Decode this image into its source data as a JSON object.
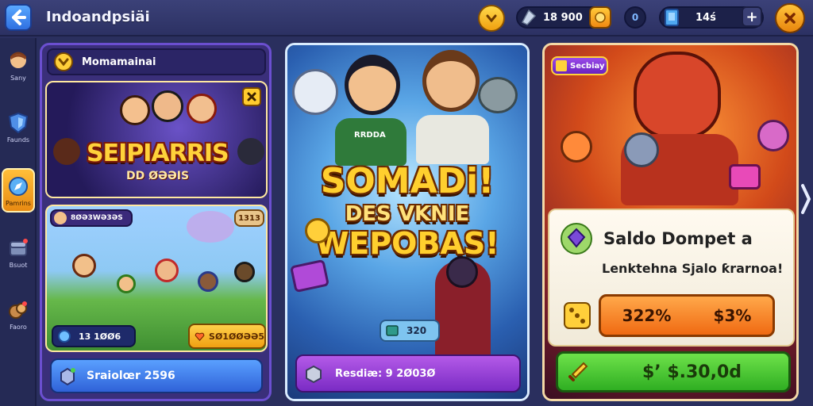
{
  "header": {
    "title": "Indoandpsiäi",
    "currency_1": "18 900",
    "currency_2": "0",
    "currency_3": "14ś",
    "add_label": "+"
  },
  "sidebar": {
    "items": [
      {
        "label": "Sany",
        "icon": "hero-avatar-icon"
      },
      {
        "label": "Faunds",
        "icon": "shield-icon"
      },
      {
        "label": "Pamrins",
        "icon": "compass-icon"
      },
      {
        "label": "Bsuot",
        "icon": "chest-icon"
      },
      {
        "label": "Faoro",
        "icon": "gift-icon"
      }
    ]
  },
  "left_panel": {
    "header_label": "Momamainai",
    "card1": {
      "title": "SEIPIARRIS",
      "subtitle": "DD ØƏƏIS"
    },
    "card2": {
      "badge": "8ØƏ3WƏ3ƏS",
      "corner": "1313",
      "stat_value": "13 1ØØ6",
      "price": "SØ1ØØƏƏ5"
    },
    "bottom_button": "Sraiolœr 2596"
  },
  "middle_panel": {
    "title_line1": "SOMADi!",
    "title_line2": "DES VKNIE",
    "title_line3": "WEPOBAS!",
    "shirt_text": "RRDDA",
    "stat_value": "320",
    "bottom_button": "Resdiæ: 9 2Ø03Ø"
  },
  "right_panel": {
    "tag": "Secbiay",
    "offer_title": "Saldo Dompet a",
    "offer_sub": "Lenktehna Sjalo ƙrarnoa!",
    "discount_left": "322%",
    "discount_right": "$3%",
    "buy_button": "$’ $.30,0d"
  },
  "colors": {
    "accent_orange": "#f47a1a",
    "accent_green": "#3fbe2e",
    "accent_purple": "#8e3fd6",
    "accent_blue": "#3b7fe0"
  }
}
